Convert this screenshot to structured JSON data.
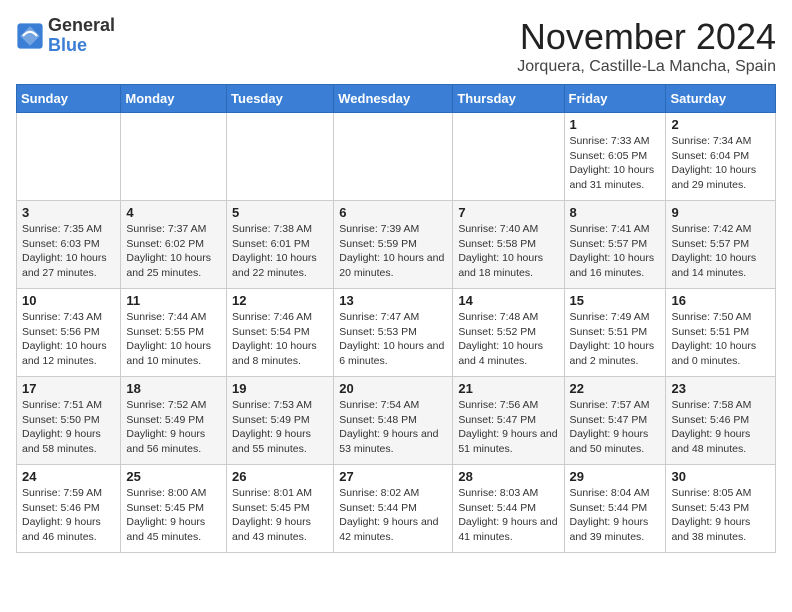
{
  "header": {
    "logo_line1": "General",
    "logo_line2": "Blue",
    "month_year": "November 2024",
    "location": "Jorquera, Castille-La Mancha, Spain"
  },
  "weekdays": [
    "Sunday",
    "Monday",
    "Tuesday",
    "Wednesday",
    "Thursday",
    "Friday",
    "Saturday"
  ],
  "weeks": [
    [
      {
        "day": "",
        "info": ""
      },
      {
        "day": "",
        "info": ""
      },
      {
        "day": "",
        "info": ""
      },
      {
        "day": "",
        "info": ""
      },
      {
        "day": "",
        "info": ""
      },
      {
        "day": "1",
        "info": "Sunrise: 7:33 AM\nSunset: 6:05 PM\nDaylight: 10 hours and 31 minutes."
      },
      {
        "day": "2",
        "info": "Sunrise: 7:34 AM\nSunset: 6:04 PM\nDaylight: 10 hours and 29 minutes."
      }
    ],
    [
      {
        "day": "3",
        "info": "Sunrise: 7:35 AM\nSunset: 6:03 PM\nDaylight: 10 hours and 27 minutes."
      },
      {
        "day": "4",
        "info": "Sunrise: 7:37 AM\nSunset: 6:02 PM\nDaylight: 10 hours and 25 minutes."
      },
      {
        "day": "5",
        "info": "Sunrise: 7:38 AM\nSunset: 6:01 PM\nDaylight: 10 hours and 22 minutes."
      },
      {
        "day": "6",
        "info": "Sunrise: 7:39 AM\nSunset: 5:59 PM\nDaylight: 10 hours and 20 minutes."
      },
      {
        "day": "7",
        "info": "Sunrise: 7:40 AM\nSunset: 5:58 PM\nDaylight: 10 hours and 18 minutes."
      },
      {
        "day": "8",
        "info": "Sunrise: 7:41 AM\nSunset: 5:57 PM\nDaylight: 10 hours and 16 minutes."
      },
      {
        "day": "9",
        "info": "Sunrise: 7:42 AM\nSunset: 5:57 PM\nDaylight: 10 hours and 14 minutes."
      }
    ],
    [
      {
        "day": "10",
        "info": "Sunrise: 7:43 AM\nSunset: 5:56 PM\nDaylight: 10 hours and 12 minutes."
      },
      {
        "day": "11",
        "info": "Sunrise: 7:44 AM\nSunset: 5:55 PM\nDaylight: 10 hours and 10 minutes."
      },
      {
        "day": "12",
        "info": "Sunrise: 7:46 AM\nSunset: 5:54 PM\nDaylight: 10 hours and 8 minutes."
      },
      {
        "day": "13",
        "info": "Sunrise: 7:47 AM\nSunset: 5:53 PM\nDaylight: 10 hours and 6 minutes."
      },
      {
        "day": "14",
        "info": "Sunrise: 7:48 AM\nSunset: 5:52 PM\nDaylight: 10 hours and 4 minutes."
      },
      {
        "day": "15",
        "info": "Sunrise: 7:49 AM\nSunset: 5:51 PM\nDaylight: 10 hours and 2 minutes."
      },
      {
        "day": "16",
        "info": "Sunrise: 7:50 AM\nSunset: 5:51 PM\nDaylight: 10 hours and 0 minutes."
      }
    ],
    [
      {
        "day": "17",
        "info": "Sunrise: 7:51 AM\nSunset: 5:50 PM\nDaylight: 9 hours and 58 minutes."
      },
      {
        "day": "18",
        "info": "Sunrise: 7:52 AM\nSunset: 5:49 PM\nDaylight: 9 hours and 56 minutes."
      },
      {
        "day": "19",
        "info": "Sunrise: 7:53 AM\nSunset: 5:49 PM\nDaylight: 9 hours and 55 minutes."
      },
      {
        "day": "20",
        "info": "Sunrise: 7:54 AM\nSunset: 5:48 PM\nDaylight: 9 hours and 53 minutes."
      },
      {
        "day": "21",
        "info": "Sunrise: 7:56 AM\nSunset: 5:47 PM\nDaylight: 9 hours and 51 minutes."
      },
      {
        "day": "22",
        "info": "Sunrise: 7:57 AM\nSunset: 5:47 PM\nDaylight: 9 hours and 50 minutes."
      },
      {
        "day": "23",
        "info": "Sunrise: 7:58 AM\nSunset: 5:46 PM\nDaylight: 9 hours and 48 minutes."
      }
    ],
    [
      {
        "day": "24",
        "info": "Sunrise: 7:59 AM\nSunset: 5:46 PM\nDaylight: 9 hours and 46 minutes."
      },
      {
        "day": "25",
        "info": "Sunrise: 8:00 AM\nSunset: 5:45 PM\nDaylight: 9 hours and 45 minutes."
      },
      {
        "day": "26",
        "info": "Sunrise: 8:01 AM\nSunset: 5:45 PM\nDaylight: 9 hours and 43 minutes."
      },
      {
        "day": "27",
        "info": "Sunrise: 8:02 AM\nSunset: 5:44 PM\nDaylight: 9 hours and 42 minutes."
      },
      {
        "day": "28",
        "info": "Sunrise: 8:03 AM\nSunset: 5:44 PM\nDaylight: 9 hours and 41 minutes."
      },
      {
        "day": "29",
        "info": "Sunrise: 8:04 AM\nSunset: 5:44 PM\nDaylight: 9 hours and 39 minutes."
      },
      {
        "day": "30",
        "info": "Sunrise: 8:05 AM\nSunset: 5:43 PM\nDaylight: 9 hours and 38 minutes."
      }
    ]
  ]
}
